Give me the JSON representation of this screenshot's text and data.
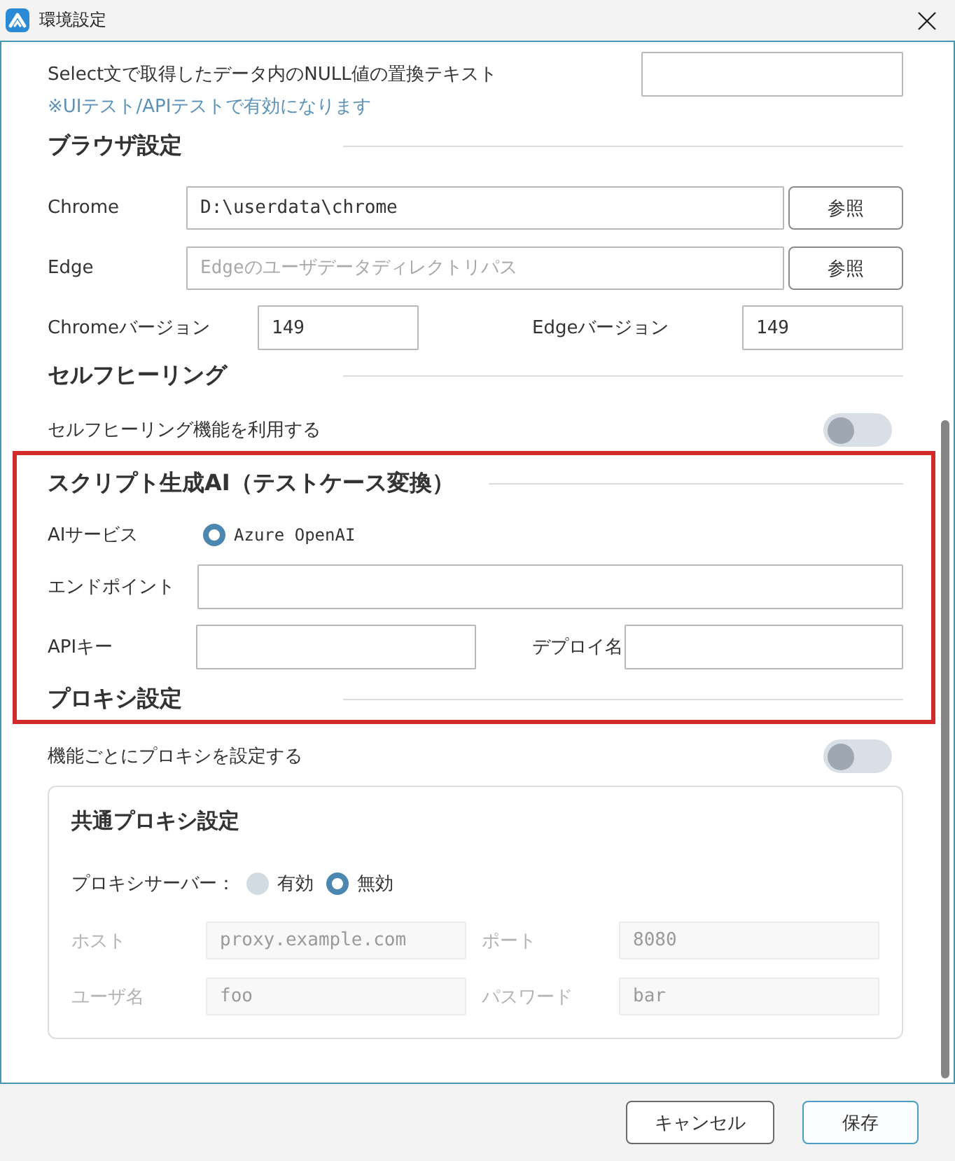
{
  "window": {
    "title": "環境設定"
  },
  "general": {
    "null_text_label": "Select文で取得したデータ内のNULL値の置換テキスト",
    "note": "※UIテスト/APIテストで有効になります"
  },
  "browser": {
    "heading": "ブラウザ設定",
    "paths": [
      {
        "label": "Chrome",
        "value": "D:\\userdata\\chrome",
        "button": "参照"
      },
      {
        "label": "Edge",
        "placeholder": "Edgeのユーザデータディレクトリパス",
        "button": "参照"
      }
    ],
    "versions": [
      {
        "label": "Chromeバージョン",
        "value": "149"
      },
      {
        "label": "Edgeバージョン",
        "value": "149"
      }
    ]
  },
  "self_healing": {
    "heading": "セルフヒーリング",
    "toggle": {
      "label": "セルフヒーリング機能を利用する",
      "on": false
    }
  },
  "ai_script": {
    "highlighted": true,
    "heading": "スクリプト生成AI（テストケース変換）",
    "service": {
      "label": "AIサービス",
      "options": [
        {
          "label": "Azure OpenAI",
          "selected": true
        }
      ]
    },
    "endpoint": {
      "label": "エンドポイント"
    },
    "credentials": [
      {
        "label": "APIキー"
      },
      {
        "label": "デプロイ名"
      }
    ]
  },
  "proxy": {
    "heading": "プロキシ設定",
    "toggle": {
      "label": "機能ごとにプロキシを設定する",
      "on": false
    },
    "common": {
      "heading": "共通プロキシ設定",
      "server_label": "プロキシサーバー：",
      "options": [
        {
          "label": "有効",
          "selected": false
        },
        {
          "label": "無効",
          "selected": true
        }
      ],
      "fields": [
        {
          "label": "ホスト",
          "placeholder": "proxy.example.com",
          "disabled": true
        },
        {
          "label": "ポート",
          "placeholder": "8080",
          "disabled": true
        },
        {
          "label": "ユーザ名",
          "placeholder": "foo",
          "disabled": true
        },
        {
          "label": "パスワード",
          "placeholder": "bar",
          "disabled": true
        }
      ]
    }
  },
  "buttons": [
    {
      "label": "キャンセル",
      "kind": "secondary"
    },
    {
      "label": "保存",
      "kind": "primary"
    }
  ]
}
